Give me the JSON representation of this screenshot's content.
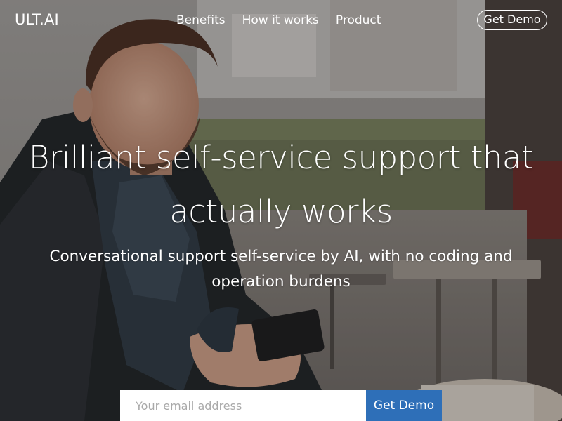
{
  "brand": {
    "logo_text": "ULT.AI"
  },
  "nav": {
    "links": [
      {
        "label": "Benefits"
      },
      {
        "label": "How it works"
      },
      {
        "label": "Product"
      }
    ],
    "cta_label": "Get Demo"
  },
  "hero": {
    "headline": "Brilliant self-service support that actually works",
    "subheadline": "Conversational support self-service by AI, with no coding and operation burdens",
    "background_image": "man-with-phone-cafe-photo"
  },
  "signup": {
    "email_placeholder": "Your email address",
    "submit_label": "Get Demo"
  },
  "colors": {
    "accent": "#2e6fb8",
    "text": "#ffffff",
    "input_background": "#ffffff",
    "placeholder": "#a9a9a9"
  }
}
